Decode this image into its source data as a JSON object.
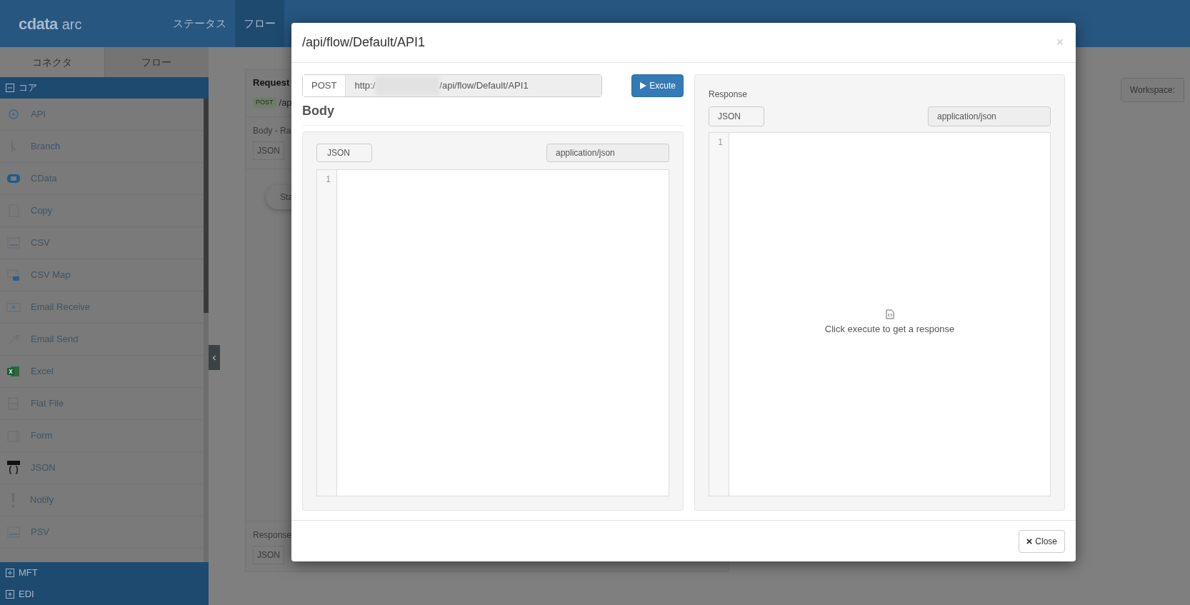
{
  "topbar": {
    "logo_main": "cdata",
    "logo_sub": "arc",
    "nav": [
      {
        "label": "ステータス",
        "selected": false
      },
      {
        "label": "フロー",
        "selected": true
      }
    ]
  },
  "sidebar": {
    "tabs": [
      {
        "label": "コネクタ",
        "selected": true
      },
      {
        "label": "フロー",
        "selected": false
      }
    ],
    "groups": [
      {
        "label": "コア",
        "expanded": true,
        "items": [
          "API",
          "Branch",
          "CData",
          "Copy",
          "CSV",
          "CSV Map",
          "Email Receive",
          "Email Send",
          "Excel",
          "Flat File",
          "Form",
          "JSON",
          "Notify",
          "PSV"
        ]
      },
      {
        "label": "MFT",
        "expanded": false
      },
      {
        "label": "EDI",
        "expanded": false
      }
    ]
  },
  "background_panel": {
    "title": "Request",
    "method_badge": "POST",
    "path": "/ap",
    "body_label": "Body - Ra",
    "body_format": "JSON",
    "start_button": "Sta",
    "response_label": "Response",
    "response_format": "JSON"
  },
  "workspace_button": "Workspace:",
  "modal": {
    "title": "/api/flow/Default/API1",
    "close_symbol": "×",
    "request": {
      "method": "POST",
      "url_start": "http:/",
      "url_end": "/api/flow/Default/API1",
      "execute_label": "Excute",
      "body_heading": "Body",
      "format": "JSON",
      "content_type": "application/json",
      "line_numbers": [
        "1"
      ]
    },
    "response": {
      "label": "Response",
      "format": "JSON",
      "content_type": "application/json",
      "line_numbers": [
        "1"
      ],
      "empty_message": "Click execute to get a response"
    },
    "footer_button": "Close"
  }
}
